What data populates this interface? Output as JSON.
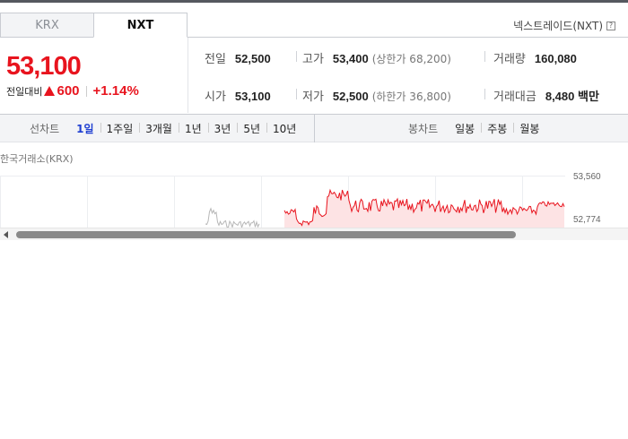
{
  "tabs": [
    {
      "label": "KRX",
      "active": false
    },
    {
      "label": "NXT",
      "active": true
    }
  ],
  "nxt_link": "넥스트레이드(NXT)",
  "price": {
    "current": "53,100",
    "change_label": "전일대비",
    "change_value": "600",
    "change_percent": "+1.14%",
    "direction": "up",
    "up_color": "#e8141e"
  },
  "stats": {
    "prev_close": {
      "label": "전일",
      "value": "52,500"
    },
    "high": {
      "label": "고가",
      "value": "53,400",
      "sub": "(상한가 68,200)"
    },
    "volume": {
      "label": "거래량",
      "value": "160,080"
    },
    "open": {
      "label": "시가",
      "value": "53,100"
    },
    "low": {
      "label": "저가",
      "value": "52,500",
      "sub": "(하한가 36,800)"
    },
    "trade_value": {
      "label": "거래대금",
      "value": "8,480 백만"
    }
  },
  "line_chart_controls": {
    "title": "선차트",
    "periods": [
      "1일",
      "1주일",
      "3개월",
      "1년",
      "3년",
      "5년",
      "10년"
    ],
    "active_period": "1일"
  },
  "candle_chart_controls": {
    "title": "봉차트",
    "periods": [
      "일봉",
      "주봉",
      "월봉"
    ]
  },
  "market_label": "한국거래소(KRX)",
  "chart_data": {
    "type": "line",
    "y_ticks": [
      "53,560",
      "52,774"
    ],
    "ylim": [
      52700,
      53560
    ],
    "line_color": "#e8141e",
    "fill_color": "#fde3e4",
    "premarket_color": "#b7b7b7"
  }
}
